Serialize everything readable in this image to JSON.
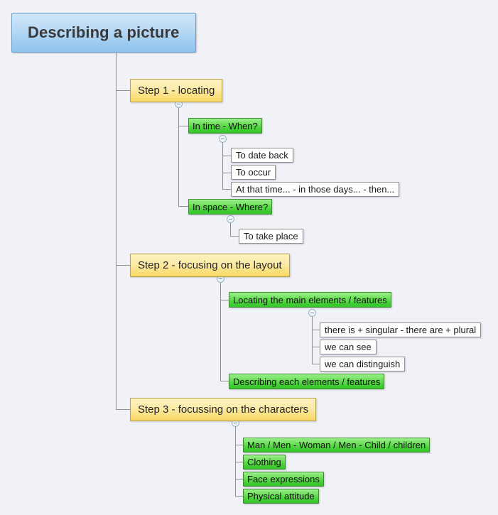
{
  "diagram": {
    "type": "mindmap",
    "background_color": "#f0f2f7",
    "root": {
      "label": "Describing a picture",
      "color": "#9fcdf0",
      "level": "root"
    },
    "toggle_icon": "collapse-minus-icon",
    "branches": [
      {
        "label": "Step 1 - locating",
        "color": "#fadf7b",
        "children": [
          {
            "label": "In time - When?",
            "color": "#43cf35",
            "children": [
              {
                "label": "To date back",
                "color": "#ffffff"
              },
              {
                "label": "To occur",
                "color": "#ffffff"
              },
              {
                "label": "At that time... - in those days... - then...",
                "color": "#ffffff"
              }
            ]
          },
          {
            "label": "In space - Where?",
            "color": "#43cf35",
            "children": [
              {
                "label": "To take place",
                "color": "#ffffff"
              }
            ]
          }
        ]
      },
      {
        "label": "Step 2 - focusing on the layout",
        "color": "#fadf7b",
        "children": [
          {
            "label": "Locating the main elements / features",
            "color": "#43cf35",
            "children": [
              {
                "label": "there is + singular - there are + plural",
                "color": "#ffffff"
              },
              {
                "label": "we can see",
                "color": "#ffffff"
              },
              {
                "label": "we can distinguish",
                "color": "#ffffff"
              }
            ]
          },
          {
            "label": "Describing each elements / features",
            "color": "#43cf35",
            "children": []
          }
        ]
      },
      {
        "label": "Step 3 - focussing on the characters",
        "color": "#fadf7b",
        "children": [
          {
            "label": "Man / Men - Woman / Men - Child / children",
            "color": "#43cf35"
          },
          {
            "label": "Clothing",
            "color": "#43cf35"
          },
          {
            "label": "Face expressions",
            "color": "#43cf35"
          },
          {
            "label": "Physical attitude",
            "color": "#43cf35"
          }
        ]
      }
    ]
  }
}
